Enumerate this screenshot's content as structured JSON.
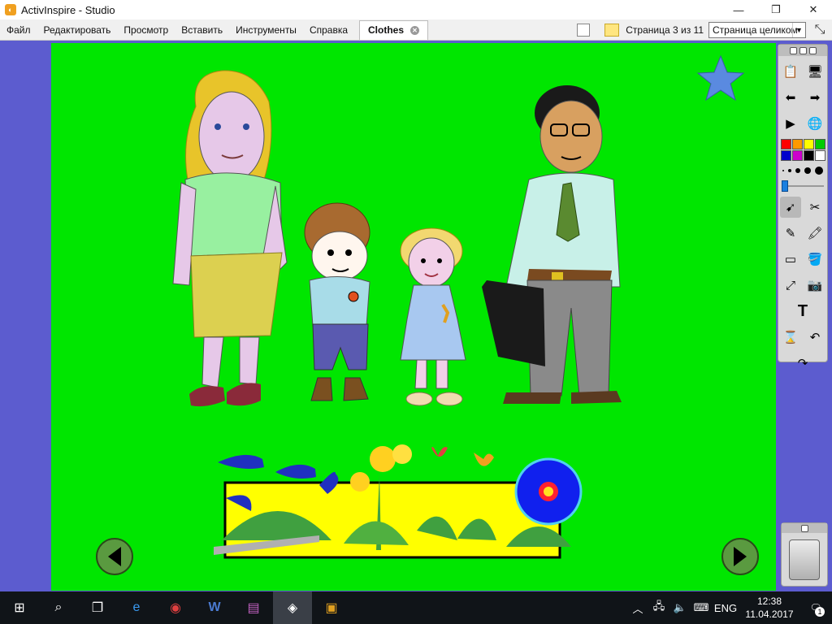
{
  "window": {
    "title": "ActivInspire - Studio",
    "app_icon": "activinspire-icon",
    "controls": [
      "minimize-icon",
      "maximize-icon",
      "close-icon"
    ]
  },
  "menu": {
    "items": [
      "Файл",
      "Редактировать",
      "Просмотр",
      "Вставить",
      "Инструменты",
      "Справка"
    ],
    "tab_label": "Clothes",
    "page_indicator": "Страница 3 из 11",
    "zoom_select": "Страница целиком"
  },
  "canvas": {
    "background": "#00e600",
    "scene": [
      "mother",
      "boy",
      "girl",
      "father-with-briefcase",
      "star",
      "flowers-in-box",
      "back-arrow",
      "forward-arrow"
    ]
  },
  "toolbox": {
    "colors": [
      "#ff0000",
      "#ff9900",
      "#ffff00",
      "#00cc00",
      "#0000cc",
      "#cc00cc",
      "#000000",
      "#ffffff"
    ],
    "tools": [
      "flipchart-browser-icon",
      "magic-tools-icon",
      "previous-page-icon",
      "next-page-icon",
      "play-icon",
      "color-picker-icon",
      "select-icon",
      "tools-icon",
      "pen-icon",
      "highlighter-icon",
      "eraser-icon",
      "fill-icon",
      "connector-icon",
      "camera-icon",
      "text-icon",
      "clear-icon",
      "undo-icon",
      "redo-icon"
    ]
  },
  "taskbar": {
    "apps": [
      "windows-start-icon",
      "search-icon",
      "task-view-icon",
      "edge-icon",
      "chrome-icon",
      "word-icon",
      "winrar-icon",
      "activinspire-icon",
      "wps-icon"
    ],
    "language": "ENG",
    "time": "12:38",
    "date": "11.04.2017",
    "notifications": "1"
  }
}
